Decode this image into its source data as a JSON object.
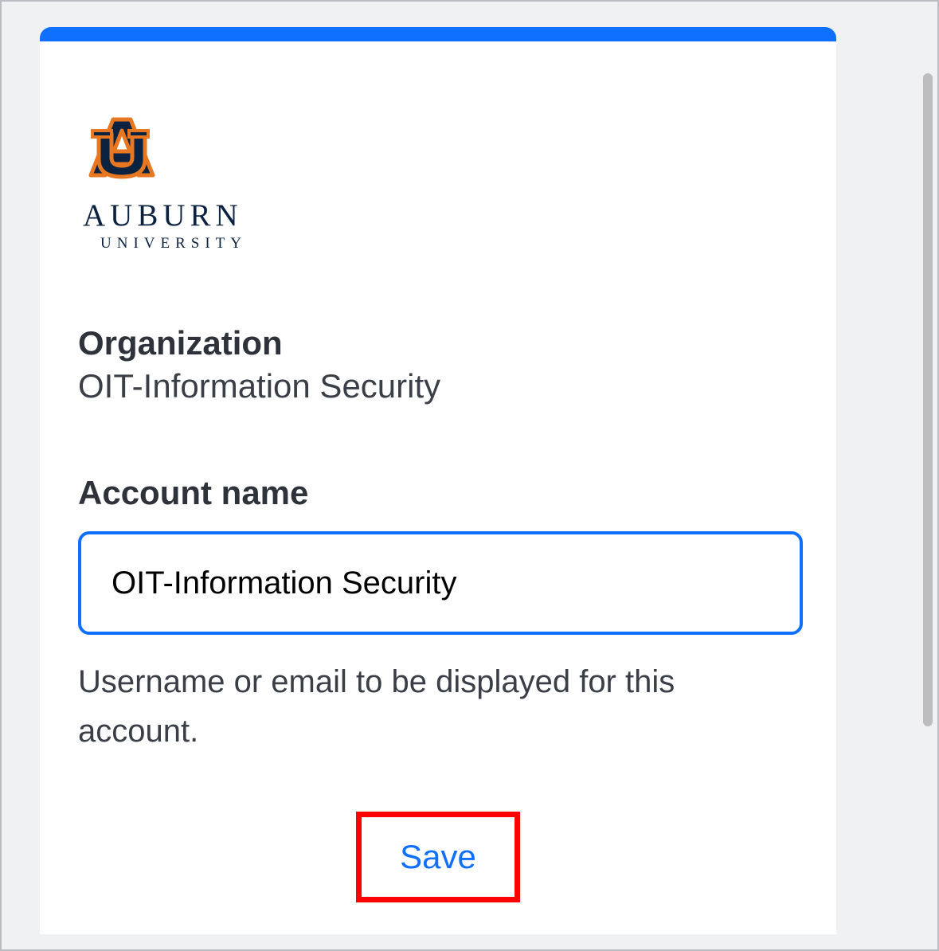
{
  "logo": {
    "text_main": "AUBURN",
    "text_sub": "UNIVERSITY"
  },
  "organization": {
    "label": "Organization",
    "value": "OIT-Information Security"
  },
  "account_name": {
    "label": "Account name",
    "value": "OIT-Information Security",
    "help": "Username or email to be displayed for this account."
  },
  "actions": {
    "save_label": "Save"
  }
}
